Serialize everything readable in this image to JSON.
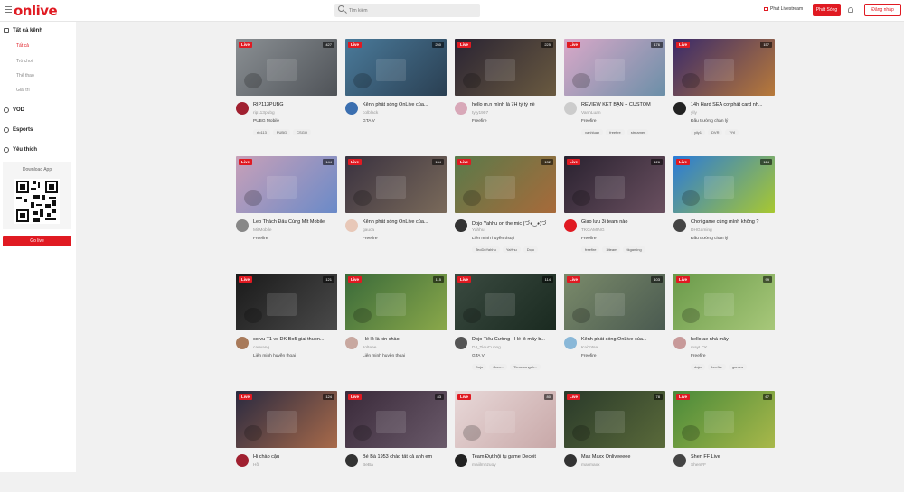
{
  "header": {
    "logo": "onlive",
    "search_placeholder": "Tìm kiếm",
    "stream_link": "Phát Livestream",
    "go_live": "Phát Sóng",
    "login": "Đăng nhập"
  },
  "sidebar": {
    "sections": [
      {
        "label": "Tất cả kênh",
        "icon": "home-icon"
      },
      {
        "label": "VOD",
        "icon": "play-circle-icon"
      },
      {
        "label": "Esports",
        "icon": "trophy-icon"
      },
      {
        "label": "Yêu thích",
        "icon": "heart-icon"
      }
    ],
    "subitems": [
      "Tất cả",
      "Trò chơi",
      "Thể thao",
      "Giải trí"
    ],
    "download_label": "Download App",
    "go_live": "Go live"
  },
  "colors": {
    "accent": "#e01a22",
    "background": "#f1f1f1"
  },
  "streams": [
    {
      "title": "RIP113PUBG",
      "channel": "rip113pubg",
      "game": "PUBG Mobile",
      "viewers": "427",
      "tags": [
        "rip113",
        "PUBG",
        "CSGO"
      ],
      "thumb": [
        "#8a8f93",
        "#4f5358"
      ],
      "avatar": "#a02030"
    },
    {
      "title": "Kênh phát sóng OnLive của...",
      "channel": "colblack",
      "game": "GTA V",
      "viewers": "250",
      "tags": [],
      "thumb": [
        "#4a7a9a",
        "#2a3f52"
      ],
      "avatar": "#3b6fb0"
    },
    {
      "title": "hello m.n mình là 7H tỷ tỷ nè",
      "channel": "tyty1907",
      "game": "Freefire",
      "viewers": "225",
      "tags": [],
      "thumb": [
        "#2a2433",
        "#6a5a40"
      ],
      "avatar": "#d8a8b8"
    },
    {
      "title": "REVIEW KẾT BẠN + CUSTOM",
      "channel": "VanhLuan",
      "game": "Freefire",
      "viewers": "176",
      "tags": [
        "vanhluan",
        "freefire",
        "streamer"
      ],
      "thumb": [
        "#d9a8c8",
        "#6b8fa8"
      ],
      "avatar": "#cccccc"
    },
    {
      "title": "14h Hard SEA cơ phát card nh...",
      "channel": "yily",
      "game": "Đấu trường chân lý",
      "viewers": "157",
      "tags": [
        "yily1",
        "DVR",
        "YiYi"
      ],
      "thumb": [
        "#3a2a6a",
        "#b87a3a"
      ],
      "avatar": "#222222"
    },
    {
      "title": "Leo Thách Đấu Cùng Mít Mobile",
      "channel": "MitMobile",
      "game": "Freefire",
      "viewers": "144",
      "tags": [],
      "thumb": [
        "#c8a0b8",
        "#6a8ac8"
      ],
      "avatar": "#888888"
    },
    {
      "title": "Kênh phát sóng OnLive của...",
      "channel": "gauca",
      "game": "Freefire",
      "viewers": "134",
      "tags": [],
      "thumb": [
        "#3a3240",
        "#7a6a5a"
      ],
      "avatar": "#e8c8b8"
    },
    {
      "title": "Dojo Yahhu on the mic (づ◕‿◕)づ",
      "channel": "Yahhu",
      "game": "Liên minh huyền thoại",
      "viewers": "132",
      "tags": [
        "TeoDoYahhu",
        "YaHhu",
        "Dojo"
      ],
      "thumb": [
        "#5a7a4a",
        "#a86a3a"
      ],
      "avatar": "#333333"
    },
    {
      "title": "Giao lưu 3i team nào",
      "channel": "TKGAMING",
      "game": "Freefire",
      "viewers": "126",
      "tags": [
        "freefire",
        "3iteam",
        "tkgaming"
      ],
      "thumb": [
        "#2a2230",
        "#6a5060"
      ],
      "avatar": "#e01a22"
    },
    {
      "title": "Chơi game cùng mình không ?",
      "channel": "DHGaming",
      "game": "Đấu trường chân lý",
      "viewers": "124",
      "tags": [],
      "thumb": [
        "#2a7ad8",
        "#a8c830"
      ],
      "avatar": "#444444"
    },
    {
      "title": "co vu T1 vs DK Bo5 giai thuon...",
      "channel": "cauvang",
      "game": "Liên minh huyền thoại",
      "viewers": "121",
      "tags": [],
      "thumb": [
        "#1a1a1a",
        "#4a4a4a"
      ],
      "avatar": "#a87a5a"
    },
    {
      "title": "Hé lô là xin chào",
      "channel": "zolteee",
      "game": "Liên minh huyền thoại",
      "viewers": "115",
      "tags": [],
      "thumb": [
        "#3a6a3a",
        "#8aa84a"
      ],
      "avatar": "#c8a8a0"
    },
    {
      "title": "Dojo Tiểu Cường - Hé lô mấy b...",
      "channel": "DJ_TieuCuong",
      "game": "GTA V",
      "viewers": "114",
      "tags": [
        "Dojo",
        "Gam...",
        "Tieucuongch..."
      ],
      "thumb": [
        "#3a4a40",
        "#1a2a20"
      ],
      "avatar": "#555555"
    },
    {
      "title": "Kênh phát sóng OnLive của...",
      "channel": "KaiToNe",
      "game": "Freefire",
      "viewers": "103",
      "tags": [],
      "thumb": [
        "#7a8a6a",
        "#4a5a50"
      ],
      "avatar": "#8ab8d8"
    },
    {
      "title": "hello ae nhá mây",
      "channel": "mayLCK",
      "game": "Freefire",
      "viewers": "99",
      "tags": [
        "doja",
        "freefire",
        "games"
      ],
      "thumb": [
        "#6a9a4a",
        "#a8c87a"
      ],
      "avatar": "#c89a9a"
    },
    {
      "title": "Hi chào cậu",
      "channel": "Hồi",
      "game": "",
      "viewers": "124",
      "tags": [],
      "thumb": [
        "#2a2a40",
        "#a86a4a"
      ],
      "avatar": "#a02030"
    },
    {
      "title": "Bé Bà 1953 chào tất cả anh em",
      "channel": "BeBa",
      "game": "",
      "viewers": "83",
      "tags": [],
      "thumb": [
        "#3a2a3a",
        "#6a5a6a"
      ],
      "avatar": "#333333"
    },
    {
      "title": "Team Đụt hội tụ game Deceit",
      "channel": "maiilmhzuoy",
      "game": "",
      "viewers": "80",
      "tags": [],
      "thumb": [
        "#e8d8d8",
        "#c8a8a8"
      ],
      "avatar": "#222222"
    },
    {
      "title": "Max Maxx Onliveeeee",
      "channel": "maxmaxx",
      "game": "",
      "viewers": "78",
      "tags": [],
      "thumb": [
        "#2a3a2a",
        "#5a6a3a"
      ],
      "avatar": "#333333"
    },
    {
      "title": "Shen FF Live",
      "channel": "ShenFF",
      "game": "",
      "viewers": "67",
      "tags": [],
      "thumb": [
        "#4a8a3a",
        "#a8b84a"
      ],
      "avatar": "#444444"
    }
  ]
}
